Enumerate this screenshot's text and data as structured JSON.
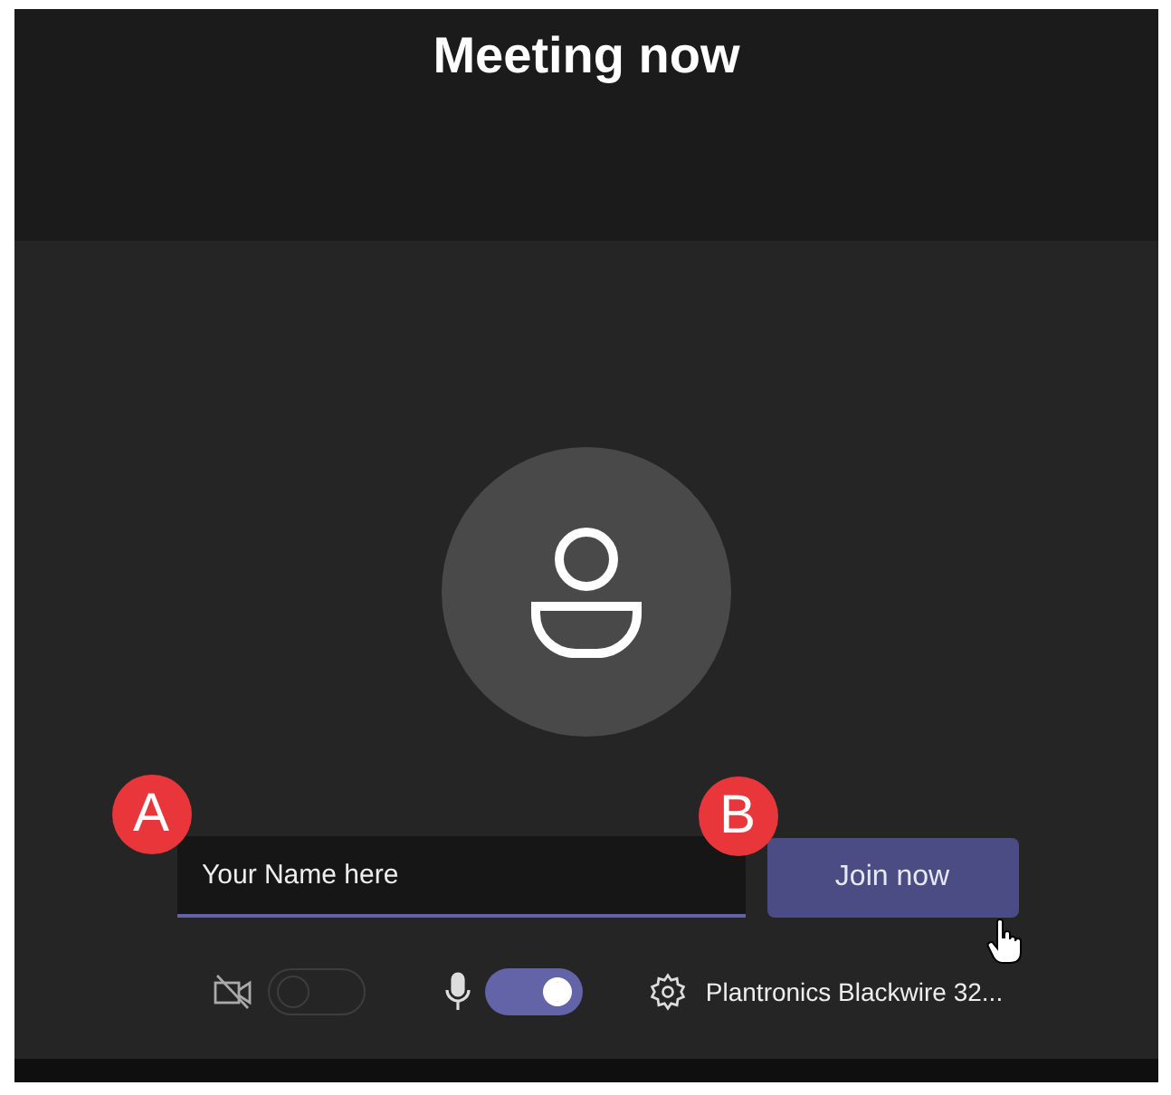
{
  "title": "Meeting now",
  "name_field": {
    "value": "Your Name here",
    "marker": "A"
  },
  "join_button": {
    "label": "Join now",
    "marker": "B"
  },
  "camera_toggle": {
    "on": false
  },
  "mic_toggle": {
    "on": true
  },
  "device": {
    "label": "Plantronics Blackwire 32..."
  }
}
